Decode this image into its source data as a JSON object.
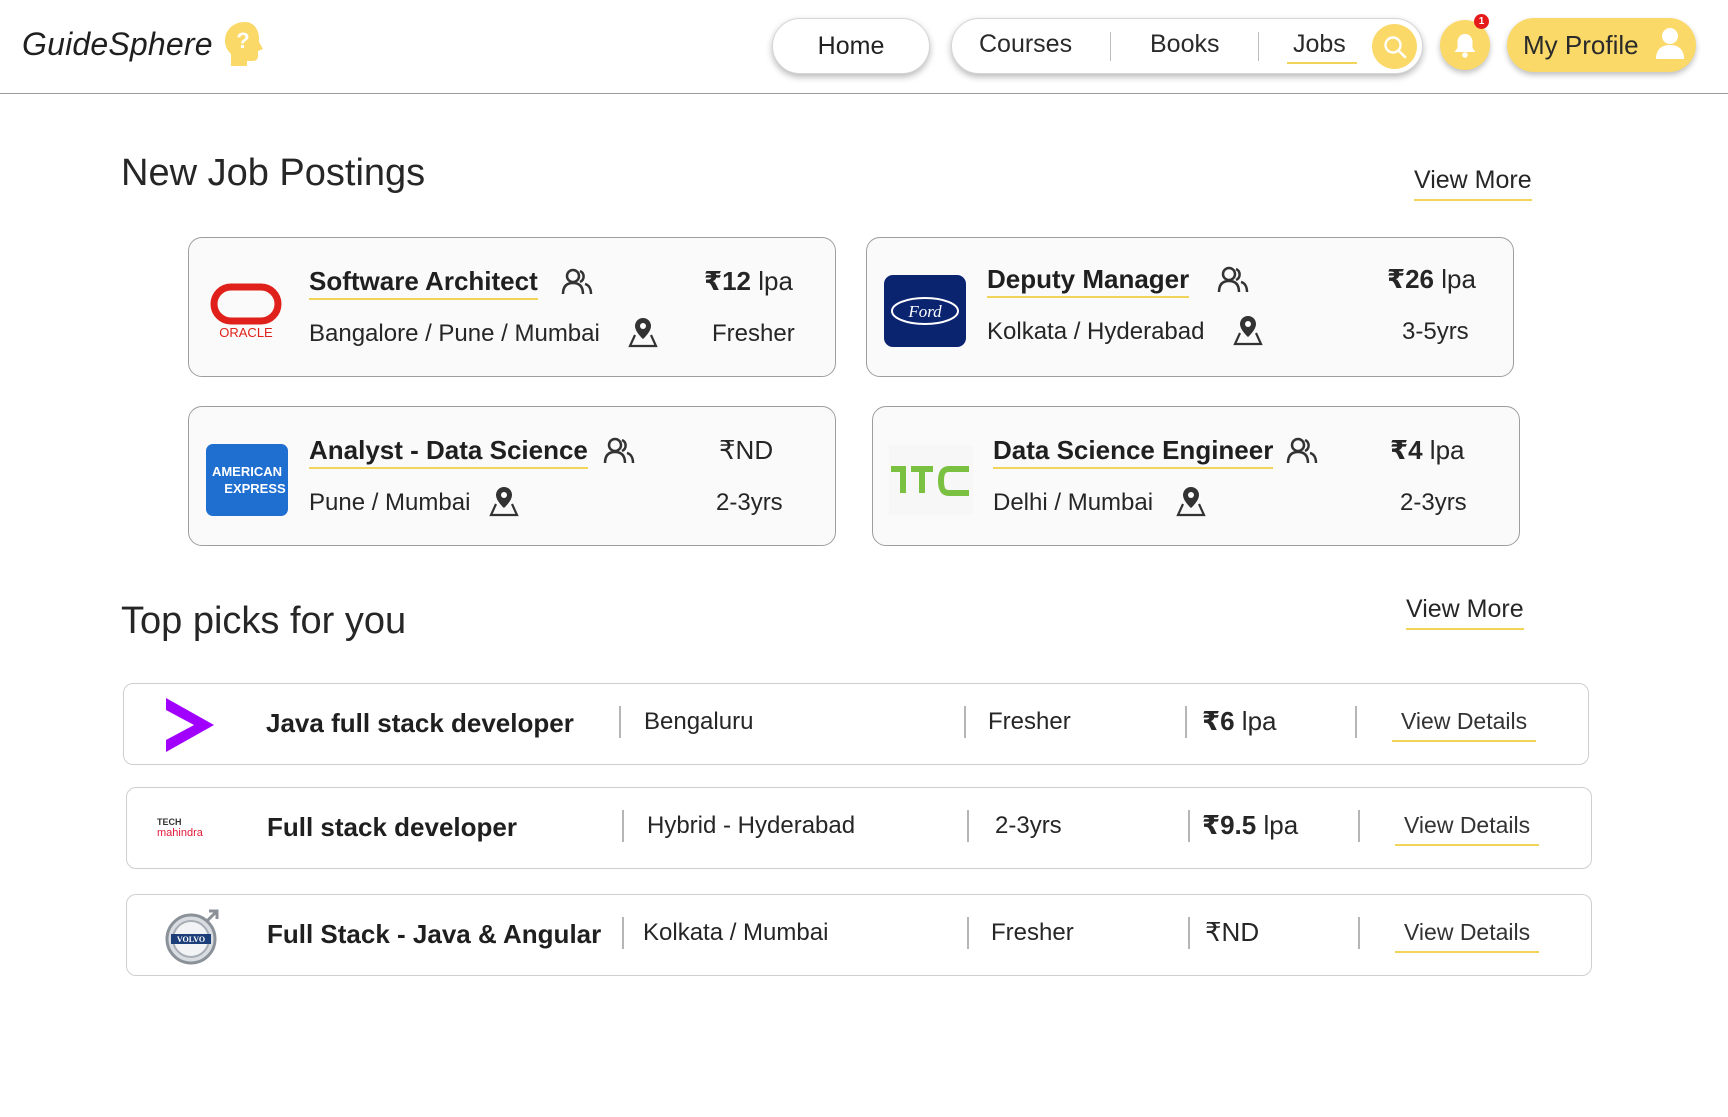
{
  "header": {
    "brand": "GuideSphere",
    "home_label": "Home",
    "nav": [
      {
        "label": "Courses"
      },
      {
        "label": "Books"
      },
      {
        "label": "Jobs",
        "active": true
      }
    ],
    "notification_count": "1",
    "profile_label": "My Profile",
    "accent_color": "#fad969"
  },
  "new_jobs": {
    "title": "New Job Postings",
    "view_more": "View More",
    "cards": [
      {
        "company_logo": "oracle-logo",
        "logo_text": "ORACLE",
        "title": "Software Architect",
        "location": "Bangalore / Pune / Mumbai",
        "salary_value": "₹12",
        "salary_unit": " lpa",
        "experience": "Fresher"
      },
      {
        "company_logo": "ford-logo",
        "logo_text": "Ford",
        "title": "Deputy Manager",
        "location": "Kolkata / Hyderabad",
        "salary_value": "₹26",
        "salary_unit": " lpa",
        "experience": "3-5yrs"
      },
      {
        "company_logo": "american-express-logo",
        "logo_text_1": "AMERICAN",
        "logo_text_2": "EXPRESS",
        "title": "Analyst - Data Science",
        "location": "Pune / Mumbai",
        "salary_value": "₹ND",
        "salary_unit": "",
        "experience": "2-3yrs"
      },
      {
        "company_logo": "htc-logo",
        "logo_text": "hTC",
        "title": "Data Science Engineer",
        "location": "Delhi / Mumbai",
        "salary_value": "₹4",
        "salary_unit": " lpa",
        "experience": "2-3yrs"
      }
    ]
  },
  "top_picks": {
    "title": "Top picks for you",
    "view_more": "View More",
    "rows": [
      {
        "company_logo": "accenture-logo",
        "title": "Java full stack developer",
        "location": "Bengaluru",
        "experience": "Fresher",
        "salary_value": "₹6",
        "salary_unit": " lpa",
        "details": "View Details"
      },
      {
        "company_logo": "tech-mahindra-logo",
        "logo_text_1": "TECH",
        "logo_text_2": "mahindra",
        "title": "Full stack developer",
        "location": "Hybrid - Hyderabad",
        "experience": "2-3yrs",
        "salary_value": "₹9.5",
        "salary_unit": " lpa",
        "details": "View Details"
      },
      {
        "company_logo": "volvo-logo",
        "logo_text": "VOLVO",
        "title": "Full Stack - Java & Angular",
        "location": "Kolkata / Mumbai",
        "experience": "Fresher",
        "salary_value": "₹ND",
        "salary_unit": "",
        "details": "View Details"
      }
    ]
  }
}
